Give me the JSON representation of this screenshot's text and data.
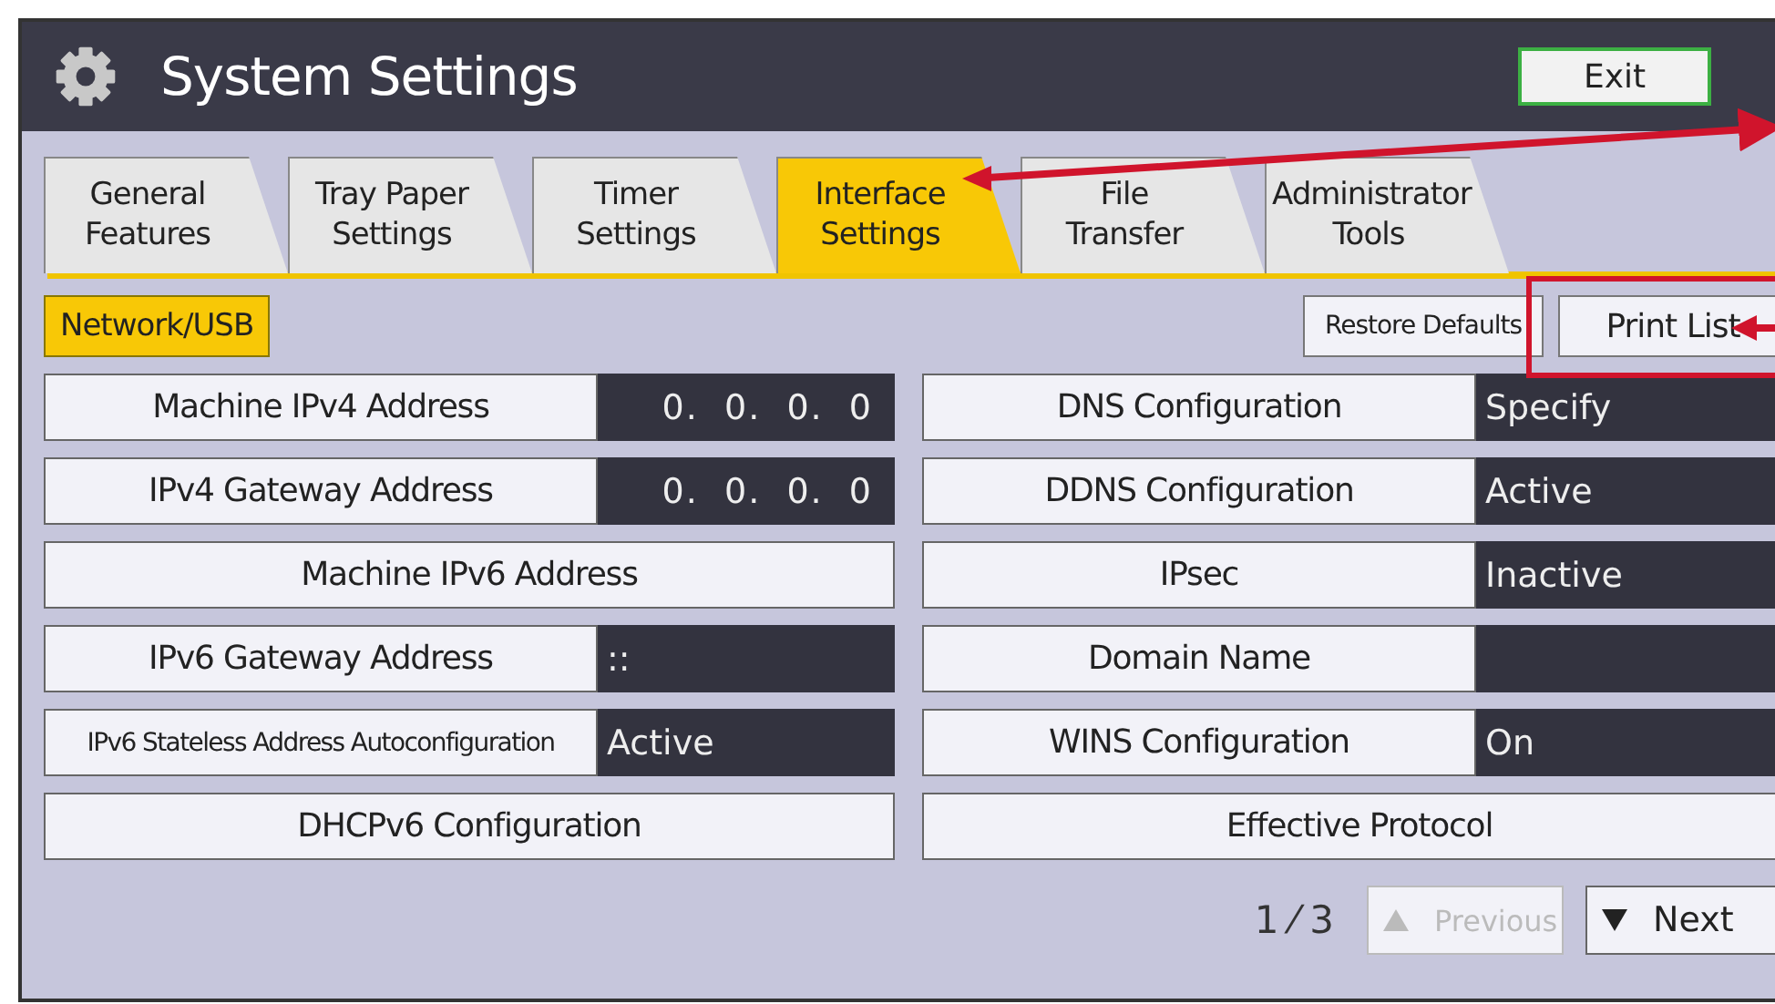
{
  "window": {
    "title": "System Settings",
    "exit_button": "Exit"
  },
  "tabs": [
    {
      "label": "General\nFeatures",
      "selected": false
    },
    {
      "label": "Tray Paper\nSettings",
      "selected": false
    },
    {
      "label": "Timer\nSettings",
      "selected": false
    },
    {
      "label": "Interface\nSettings",
      "selected": true
    },
    {
      "label": "File\nTransfer",
      "selected": false
    },
    {
      "label": "Administrator\nTools",
      "selected": false
    }
  ],
  "subtabs": [
    {
      "label": "Network/USB",
      "selected": true
    }
  ],
  "actions": [
    "Restore Defaults",
    "Print List"
  ],
  "settings": [
    {
      "kind": "address",
      "label": "Machine IPv4 Address",
      "value": "0.  0.  0.  0"
    },
    {
      "kind": "pair",
      "label": "DNS Configuration",
      "value": "Specify"
    },
    {
      "kind": "address",
      "label": "IPv4 Gateway Address",
      "value": "0.  0.  0.  0"
    },
    {
      "kind": "pair",
      "label": "DDNS Configuration",
      "value": "Active"
    },
    {
      "kind": "button",
      "label": "Machine IPv6 Address"
    },
    {
      "kind": "pair",
      "label": "IPsec",
      "value": "Inactive"
    },
    {
      "kind": "pair",
      "label": "IPv6 Gateway Address",
      "value": "::"
    },
    {
      "kind": "pair",
      "label": "Domain Name"
    },
    {
      "kind": "pair",
      "label": "IPv6 Stateless Address Autoconfiguration",
      "value": "Active"
    },
    {
      "kind": "pair",
      "label": "WINS Configuration",
      "value": "On"
    },
    {
      "kind": "button",
      "label": "DHCPv6 Configuration"
    },
    {
      "kind": "button",
      "label": "Effective Protocol"
    }
  ],
  "pager": {
    "page": "1 ⁄ 3",
    "previous": {
      "label": "Previous",
      "disabled": true
    },
    "next": {
      "label": "Next",
      "disabled": false
    }
  }
}
